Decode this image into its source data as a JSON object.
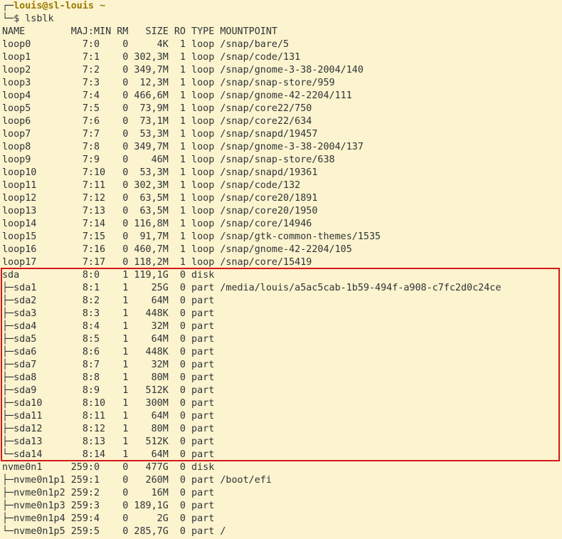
{
  "prompt": {
    "tree_top": "┌─",
    "user_host": "louis@sl-louis",
    "cwd": "~",
    "tree_bottom": "└─",
    "symbol": "$",
    "command": "lsblk"
  },
  "table": {
    "header": "NAME        MAJ:MIN RM   SIZE RO TYPE MOUNTPOINT",
    "rows": [
      "loop0         7:0    0     4K  1 loop /snap/bare/5",
      "loop1         7:1    0 302,3M  1 loop /snap/code/131",
      "loop2         7:2    0 349,7M  1 loop /snap/gnome-3-38-2004/140",
      "loop3         7:3    0  12,3M  1 loop /snap/snap-store/959",
      "loop4         7:4    0 466,6M  1 loop /snap/gnome-42-2204/111",
      "loop5         7:5    0  73,9M  1 loop /snap/core22/750",
      "loop6         7:6    0  73,1M  1 loop /snap/core22/634",
      "loop7         7:7    0  53,3M  1 loop /snap/snapd/19457",
      "loop8         7:8    0 349,7M  1 loop /snap/gnome-3-38-2004/137",
      "loop9         7:9    0    46M  1 loop /snap/snap-store/638",
      "loop10        7:10   0  53,3M  1 loop /snap/snapd/19361",
      "loop11        7:11   0 302,3M  1 loop /snap/code/132",
      "loop12        7:12   0  63,5M  1 loop /snap/core20/1891",
      "loop13        7:13   0  63,5M  1 loop /snap/core20/1950",
      "loop14        7:14   0 116,8M  1 loop /snap/core/14946",
      "loop15        7:15   0  91,7M  1 loop /snap/gtk-common-themes/1535",
      "loop16        7:16   0 460,7M  1 loop /snap/gnome-42-2204/105",
      "loop17        7:17   0 118,2M  1 loop /snap/core/15419",
      "sda           8:0    1 119,1G  0 disk",
      "├─sda1        8:1    1    25G  0 part /media/louis/a5ac5cab-1b59-494f-a908-c7fc2d0c24ce",
      "├─sda2        8:2    1    64M  0 part",
      "├─sda3        8:3    1   448K  0 part",
      "├─sda4        8:4    1    32M  0 part",
      "├─sda5        8:5    1    64M  0 part",
      "├─sda6        8:6    1   448K  0 part",
      "├─sda7        8:7    1    32M  0 part",
      "├─sda8        8:8    1    80M  0 part",
      "├─sda9        8:9    1   512K  0 part",
      "├─sda10       8:10   1   300M  0 part",
      "├─sda11       8:11   1    64M  0 part",
      "├─sda12       8:12   1    80M  0 part",
      "├─sda13       8:13   1   512K  0 part",
      "└─sda14       8:14   1    64M  0 part",
      "nvme0n1     259:0    0   477G  0 disk",
      "├─nvme0n1p1 259:1    0   260M  0 part /boot/efi",
      "├─nvme0n1p2 259:2    0    16M  0 part",
      "├─nvme0n1p3 259:3    0 189,1G  0 part",
      "├─nvme0n1p4 259:4    0     2G  0 part",
      "└─nvme0n1p5 259:5    0 285,7G  0 part /"
    ]
  },
  "colors": {
    "background": "#fcf3cf",
    "text": "#2e3436",
    "prompt_user": "#9a7a00",
    "highlight_border": "#d21a1a"
  }
}
